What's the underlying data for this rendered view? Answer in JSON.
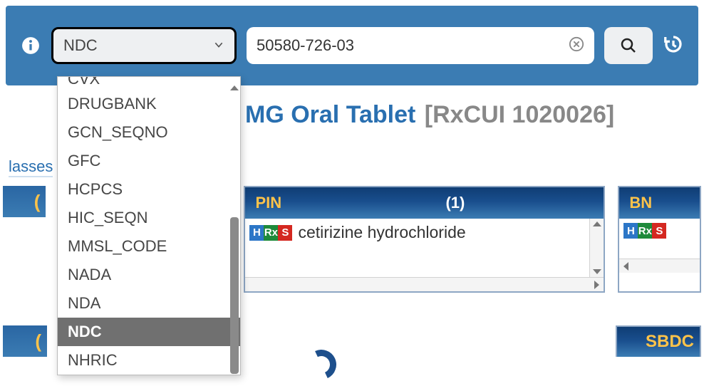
{
  "searchbar": {
    "id_type_selected": "NDC",
    "query_value": "50580-726-03",
    "placeholder": ""
  },
  "dropdown_options": [
    "CVX",
    "DRUGBANK",
    "GCN_SEQNO",
    "GFC",
    "HCPCS",
    "HIC_SEQN",
    "MMSL_CODE",
    "NADA",
    "NDA",
    "NDC",
    "NHRIC"
  ],
  "dropdown_selected": "NDC",
  "title": {
    "drug_fragment": "MG Oral Tablet",
    "rxcui_label": "[RxCUI 1020026]"
  },
  "nav": {
    "classes_link": "lasses"
  },
  "panels": {
    "left_stub": "(",
    "pin": {
      "code": "PIN",
      "count": "(1)",
      "rows": [
        {
          "badges": [
            "H",
            "Rx",
            "S"
          ],
          "text": "cetirizine hydrochloride"
        }
      ]
    },
    "bn": {
      "code": "BN",
      "rows": [
        {
          "badges": [
            "H",
            "Rx",
            "S"
          ],
          "text": ""
        }
      ]
    }
  },
  "second_row": {
    "left_stub": "(",
    "sbdc": "SBDC"
  }
}
